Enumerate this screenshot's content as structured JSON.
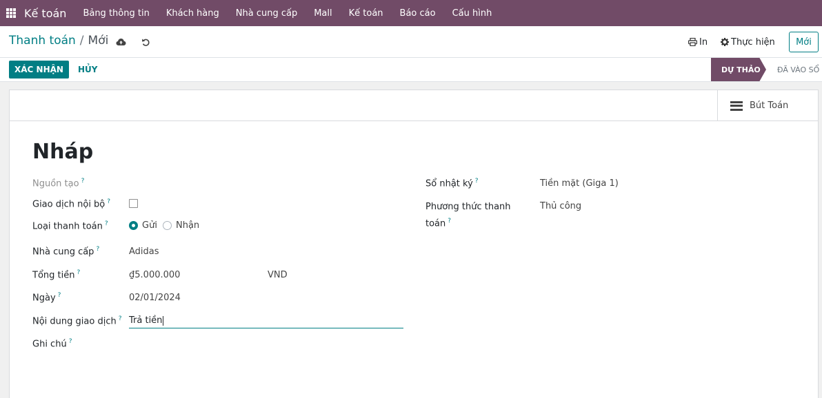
{
  "navbar": {
    "brand": "Kế toán",
    "items": [
      "Bảng thông tin",
      "Khách hàng",
      "Nhà cung cấp",
      "Mall",
      "Kế toán",
      "Báo cáo",
      "Cấu hình"
    ]
  },
  "control": {
    "breadcrumb_parent": "Thanh toán",
    "breadcrumb_sep": "/",
    "breadcrumb_current": "Mới",
    "print_label": "In",
    "action_label": "Thực hiện",
    "new_label": "Mới"
  },
  "statusbar": {
    "confirm_label": "XÁC NHẬN",
    "cancel_label": "HỦY",
    "stage_active": "DỰ THẢO",
    "stage_next": "ĐÃ VÀO SỔ"
  },
  "sheet": {
    "smart_button": "Bút Toán",
    "title": "Nháp",
    "q": "?",
    "fields": {
      "source_label": "Nguồn tạo",
      "internal_label": "Giao dịch nội bộ",
      "payment_type_label": "Loại thanh toán",
      "payment_type_send": "Gửi",
      "payment_type_receive": "Nhận",
      "vendor_label": "Nhà cung cấp",
      "vendor_value": "Adidas",
      "amount_label": "Tổng tiền",
      "amount_value": "₫5.000.000",
      "currency_value": "VND",
      "date_label": "Ngày",
      "date_value": "02/01/2024",
      "memo_label": "Nội dung giao dịch",
      "memo_value": "Trả tiền",
      "note_label": "Ghi chú",
      "journal_label": "Sổ nhật ký",
      "journal_value": "Tiền mặt (Giga 1)",
      "method_label_1": "Phương thức thanh",
      "method_label_2": "toán",
      "method_value": "Thủ công"
    }
  },
  "colors": {
    "navbar": "#714b67",
    "primary": "#017e84"
  }
}
